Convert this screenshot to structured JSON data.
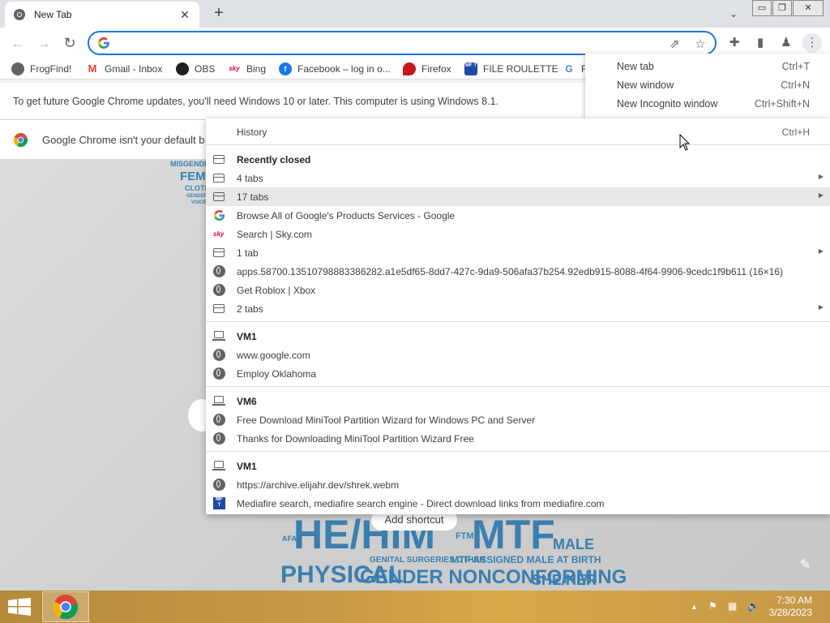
{
  "browser": {
    "tab_title": "New Tab",
    "tab_close_icon": "close-icon",
    "new_tab_icon": "plus-icon",
    "omnibox": {
      "value": "",
      "placeholder": ""
    },
    "accent": "#1a73e8"
  },
  "window_controls": {
    "minimize": "▭",
    "restore": "❐",
    "close": "✕"
  },
  "bookmarks": [
    {
      "label": "FrogFind!",
      "icon": "globe-icon"
    },
    {
      "label": "Gmail - Inbox",
      "icon": "gmail-icon"
    },
    {
      "label": "OBS",
      "icon": "github-icon"
    },
    {
      "label": "Bing",
      "icon": "sky-icon"
    },
    {
      "label": "Facebook – log in o...",
      "icon": "facebook-icon"
    },
    {
      "label": "Firefox",
      "icon": "firefox-icon"
    },
    {
      "label": "FILE ROULETTE",
      "icon": "mft-icon"
    },
    {
      "label": "F",
      "icon": "google-icon"
    }
  ],
  "infobars": {
    "update_notice": "To get future Google Chrome updates, you'll need Windows 10 or later. This computer is using Windows 8.1.",
    "default_browser": "Google Chrome isn't your default b"
  },
  "main_menu": [
    {
      "label": "New tab",
      "shortcut": "Ctrl+T"
    },
    {
      "label": "New window",
      "shortcut": "Ctrl+N"
    },
    {
      "label": "New Incognito window",
      "shortcut": "Ctrl+Shift+N"
    }
  ],
  "history_menu": {
    "history": {
      "label": "History",
      "shortcut": "Ctrl+H"
    },
    "recently_closed_header": "Recently closed",
    "recently_closed": [
      {
        "label": "4 tabs",
        "icon": "tab",
        "submenu": true
      },
      {
        "label": "17 tabs",
        "icon": "tab",
        "submenu": true,
        "highlighted": true
      },
      {
        "label": "Browse All of Google's Products  Services - Google",
        "icon": "google"
      },
      {
        "label": "Search | Sky.com",
        "icon": "sky"
      },
      {
        "label": "1 tab",
        "icon": "tab",
        "submenu": true
      },
      {
        "label": "apps.58700.13510798883386282.a1e5df65-8dd7-427c-9da9-506afa37b254.92edb915-8088-4f64-9906-9cedc1f9b611 (16×16)",
        "icon": "globe"
      },
      {
        "label": "Get Roblox | Xbox",
        "icon": "globe"
      },
      {
        "label": "2 tabs",
        "icon": "tab",
        "submenu": true
      }
    ],
    "devices": [
      {
        "name": "VM1",
        "items": [
          {
            "label": "www.google.com",
            "icon": "globe"
          },
          {
            "label": "Employ Oklahoma",
            "icon": "globe"
          }
        ]
      },
      {
        "name": "VM6",
        "items": [
          {
            "label": "Free Download MiniTool Partition Wizard for Windows PC and Server",
            "icon": "globe"
          },
          {
            "label": "Thanks for Downloading MiniTool Partition Wizard Free",
            "icon": "globe"
          }
        ]
      },
      {
        "name": "VM1",
        "items": [
          {
            "label": "https://archive.elijahr.dev/shrek.webm",
            "icon": "globe"
          },
          {
            "label": "Mediafire search, mediafire search engine - Direct download links from mediafire.com",
            "icon": "mft"
          }
        ]
      }
    ]
  },
  "ntp": {
    "add_shortcut": "Add shortcut",
    "wordcloud": [
      "MISGENDER",
      "FEMALE",
      "CLOTHING",
      "GENDER",
      "VOICE",
      "HE/HIM",
      "MTF",
      "PHYSICAL",
      "GENDER NONCONFORMING",
      "SHE/HER",
      "MTF ASSIGNED MALE AT BIRTH",
      "GENITAL SURGERIES OTHER",
      "FTM",
      "MALE",
      "AFAB"
    ]
  },
  "taskbar": {
    "time": "7:30 AM",
    "date": "3/28/2023"
  }
}
